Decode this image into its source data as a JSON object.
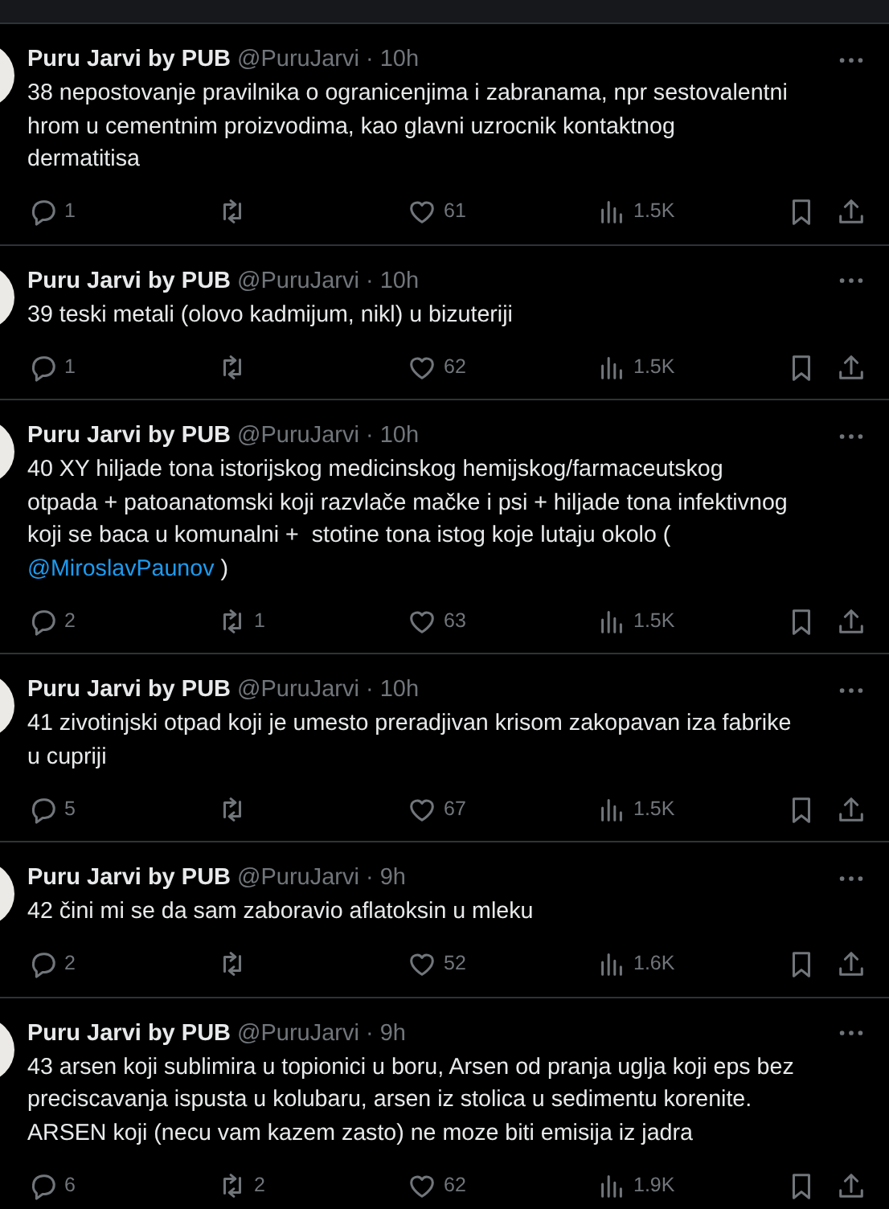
{
  "tweets": [
    {
      "author": "Puru Jarvi by PUB",
      "handle": "@PuruJarvi",
      "separator": "·",
      "time": "10h",
      "lines": [
        "38 nepostovanje pravilnika o ogranicenjima i zabranama, npr sestovalentni",
        "hrom u cementnim proizvodima, kao glavni uzrocnik kontaktnog",
        "dermatitisa"
      ],
      "replies": "1",
      "likes": "61",
      "views": "1.5K"
    },
    {
      "author": "Puru Jarvi by PUB",
      "handle": "@PuruJarvi",
      "separator": "·",
      "time": "10h",
      "lines": [
        "39 teski metali (olovo kadmijum, nikl) u bizuteriji"
      ],
      "replies": "1",
      "likes": "62",
      "views": "1.5K"
    },
    {
      "author": "Puru Jarvi by PUB",
      "handle": "@PuruJarvi",
      "separator": "·",
      "time": "10h",
      "lines": [
        "40 XY hiljade tona istorijskog medicinskog hemijskog/farmaceutskog",
        "otpada + patoanatomski koji razvlače mačke i psi + hiljade tona infektivnog",
        "koji se baca u komunalni +  stotine tona istog koje lutaju okolo (",
        [
          {
            "kind": "mention",
            "text": "@MiroslavPaunov"
          },
          {
            "kind": "text",
            "text": " )"
          }
        ]
      ],
      "replies": "2",
      "reposts": "1",
      "likes": "63",
      "views": "1.5K"
    },
    {
      "author": "Puru Jarvi by PUB",
      "handle": "@PuruJarvi",
      "separator": "·",
      "time": "10h",
      "lines": [
        "41 zivotinjski otpad koji je umesto preradjivan krisom zakopavan iza fabrike",
        "u cupriji"
      ],
      "replies": "5",
      "likes": "67",
      "views": "1.5K"
    },
    {
      "author": "Puru Jarvi by PUB",
      "handle": "@PuruJarvi",
      "separator": "·",
      "time": "9h",
      "lines": [
        "42 čini mi se da sam zaboravio aflatoksin u mleku"
      ],
      "replies": "2",
      "likes": "52",
      "views": "1.6K"
    },
    {
      "author": "Puru Jarvi by PUB",
      "handle": "@PuruJarvi",
      "separator": "·",
      "time": "9h",
      "lines": [
        "43 arsen koji sublimira u topionici u boru, Arsen od pranja uglja koji eps bez",
        "preciscavanja ispusta u kolubaru, arsen iz stolica u sedimentu korenite.",
        "ARSEN koji (necu vam kazem zasto) ne moze biti emisija iz jadra"
      ],
      "replies": "6",
      "reposts": "2",
      "likes": "62",
      "views": "1.9K"
    }
  ]
}
